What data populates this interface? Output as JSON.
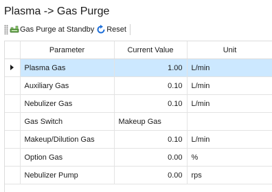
{
  "window": {
    "title": "Plasma -> Gas Purge"
  },
  "toolbar": {
    "purge_label": "Gas Purge at Standby",
    "reset_label": "Reset"
  },
  "grid": {
    "headers": [
      "Parameter",
      "Current Value",
      "Unit"
    ],
    "rows": [
      {
        "parameter": "Plasma Gas",
        "value": "1.00",
        "unit": "L/min"
      },
      {
        "parameter": "Auxiliary Gas",
        "value": "0.10",
        "unit": "L/min"
      },
      {
        "parameter": "Nebulizer Gas",
        "value": "0.10",
        "unit": "L/min"
      },
      {
        "parameter": "Gas Switch",
        "value": "Makeup Gas",
        "unit": ""
      },
      {
        "parameter": "Makeup/Dilution Gas",
        "value": "0.10",
        "unit": "L/min"
      },
      {
        "parameter": "Option Gas",
        "value": "0.00",
        "unit": "%"
      },
      {
        "parameter": "Nebulizer Pump",
        "value": "0.00",
        "unit": "rps"
      }
    ]
  },
  "colors": {
    "selection": "#cce8ff",
    "accent": "#1e6fd9"
  }
}
